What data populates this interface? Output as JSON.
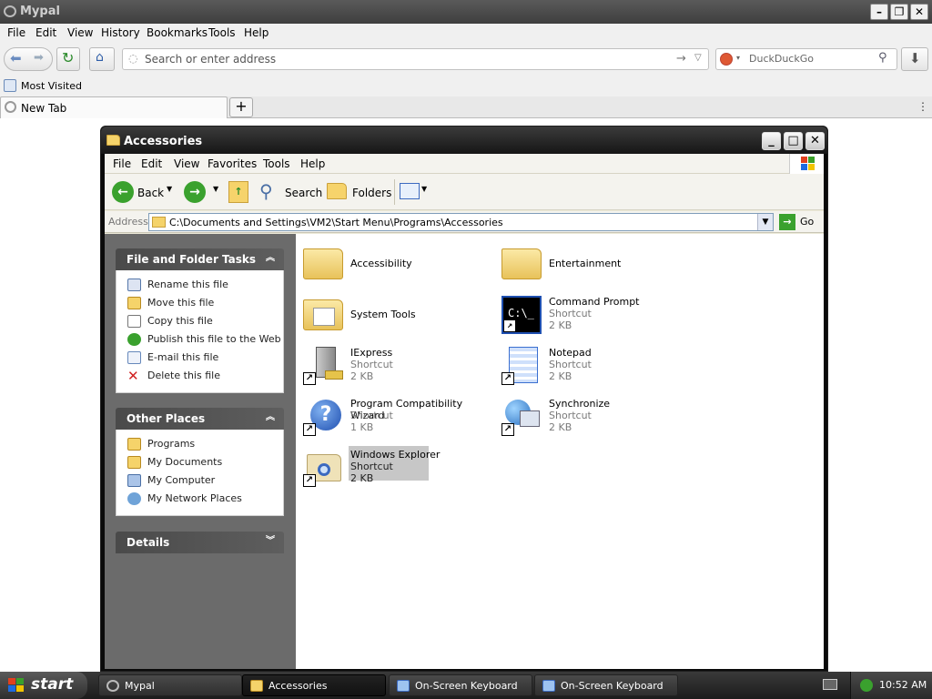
{
  "browser": {
    "title": "Mypal",
    "menu": [
      "File",
      "Edit",
      "View",
      "History",
      "Bookmarks",
      "Tools",
      "Help"
    ],
    "url_placeholder": "Search or enter address",
    "search_engine": "DuckDuckGo",
    "bookmarks": {
      "most_visited": "Most Visited"
    },
    "tab_label": "New Tab"
  },
  "explorer": {
    "title": "Accessories",
    "menu": [
      "File",
      "Edit",
      "View",
      "Favorites",
      "Tools",
      "Help"
    ],
    "toolbar": {
      "back": "Back",
      "search": "Search",
      "folders": "Folders"
    },
    "address_label": "Address",
    "address": "C:\\Documents and Settings\\VM2\\Start Menu\\Programs\\Accessories",
    "go_label": "Go",
    "tasks_panel": {
      "title": "File and Folder Tasks",
      "items": [
        "Rename this file",
        "Move this file",
        "Copy this file",
        "Publish this file to the Web",
        "E-mail this file",
        "Delete this file"
      ]
    },
    "places_panel": {
      "title": "Other Places",
      "items": [
        "Programs",
        "My Documents",
        "My Computer",
        "My Network Places"
      ]
    },
    "details_panel": {
      "title": "Details"
    },
    "files": [
      {
        "name": "Accessibility",
        "type": "",
        "size": ""
      },
      {
        "name": "Entertainment",
        "type": "",
        "size": ""
      },
      {
        "name": "System Tools",
        "type": "",
        "size": ""
      },
      {
        "name": "Command Prompt",
        "type": "Shortcut",
        "size": "2 KB"
      },
      {
        "name": "IExpress",
        "type": "Shortcut",
        "size": "2 KB"
      },
      {
        "name": "Notepad",
        "type": "Shortcut",
        "size": "2 KB"
      },
      {
        "name": "Program Compatibility Wizard",
        "type": "Shortcut",
        "size": "1 KB"
      },
      {
        "name": "Synchronize",
        "type": "Shortcut",
        "size": "2 KB"
      },
      {
        "name": "Windows Explorer",
        "type": "Shortcut",
        "size": "2 KB"
      }
    ]
  },
  "taskbar": {
    "start": "start",
    "tasks": [
      "Mypal",
      "Accessories",
      "On-Screen Keyboard",
      "On-Screen Keyboard"
    ],
    "clock": "10:52 AM"
  }
}
